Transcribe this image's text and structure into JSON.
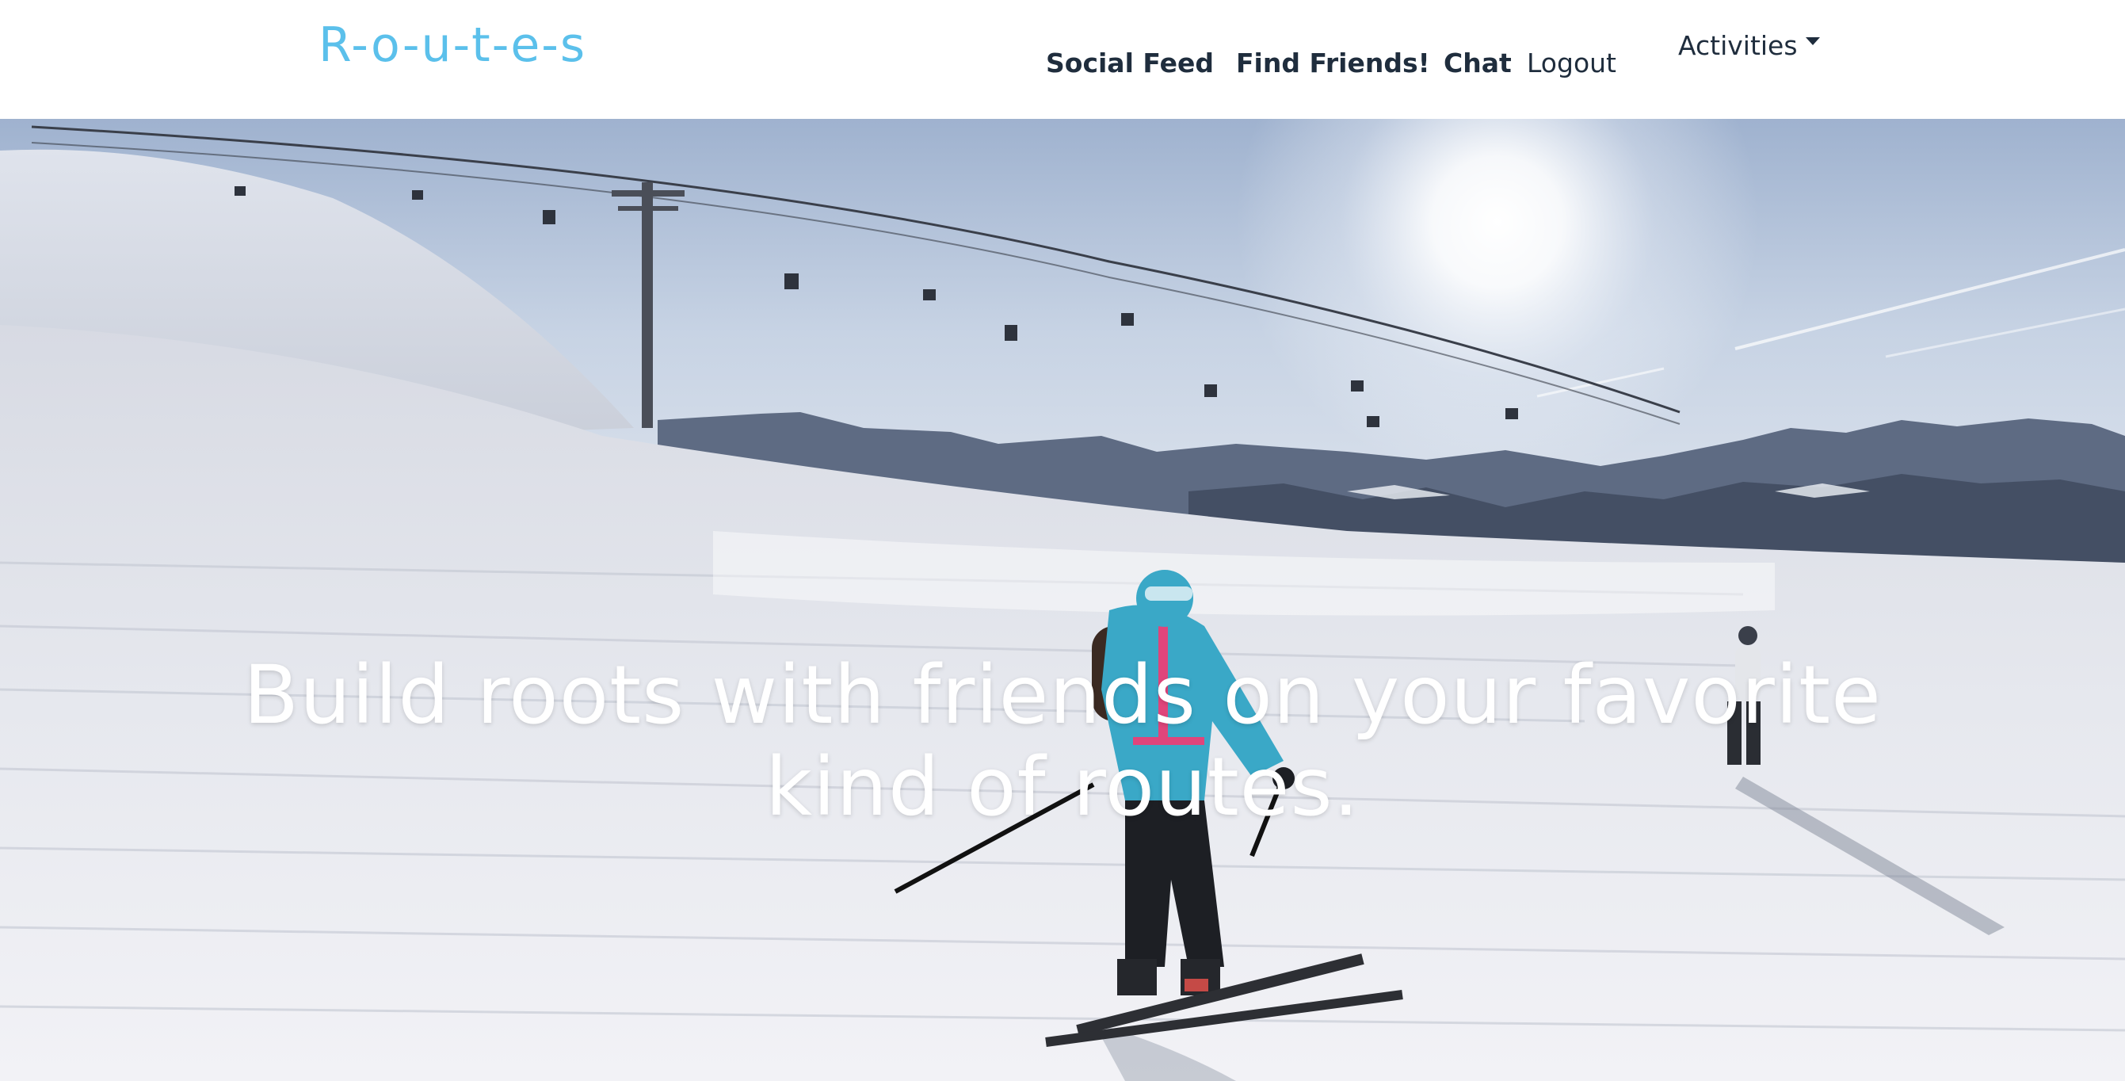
{
  "brand": {
    "text": "R-o-u-t-e-s",
    "color": "#5bc0eb"
  },
  "nav": {
    "social_feed": "Social Feed",
    "find_friends": "Find Friends!",
    "chat": "Chat",
    "logout": "Logout",
    "activities": "Activities",
    "text_color": "#1f2d3d"
  },
  "hero": {
    "headline": "Build roots with friends on your favorite kind of routes.",
    "image_subject": "ski-slope-photo"
  }
}
